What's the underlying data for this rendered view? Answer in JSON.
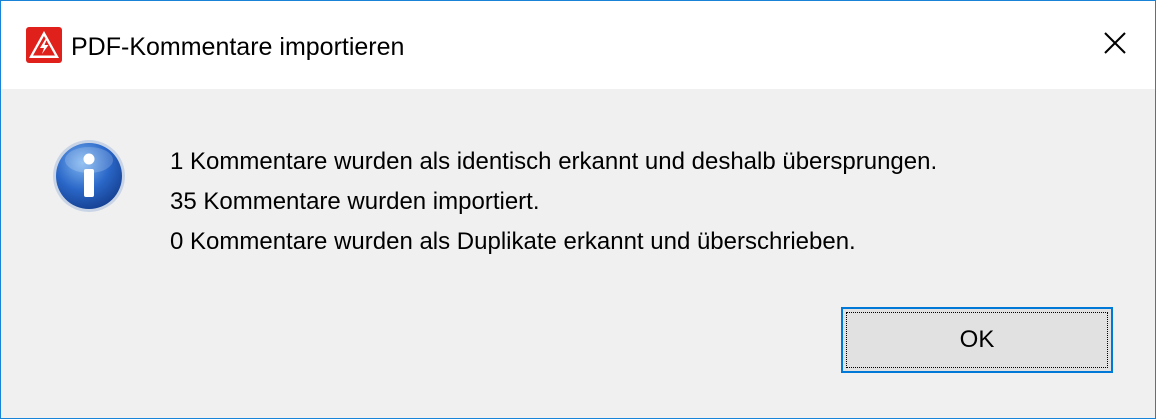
{
  "window": {
    "title": "PDF-Kommentare importieren",
    "app_icon": "warning-triangle-icon",
    "close_icon": "close-icon",
    "accent_color": "#1883d7"
  },
  "dialog": {
    "icon": "info-icon",
    "messages": [
      "1 Kommentare wurden als identisch erkannt und deshalb übersprungen.",
      "35 Kommentare wurden importiert.",
      "0 Kommentare wurden als Duplikate erkannt und überschrieben."
    ],
    "ok_label": "OK"
  }
}
